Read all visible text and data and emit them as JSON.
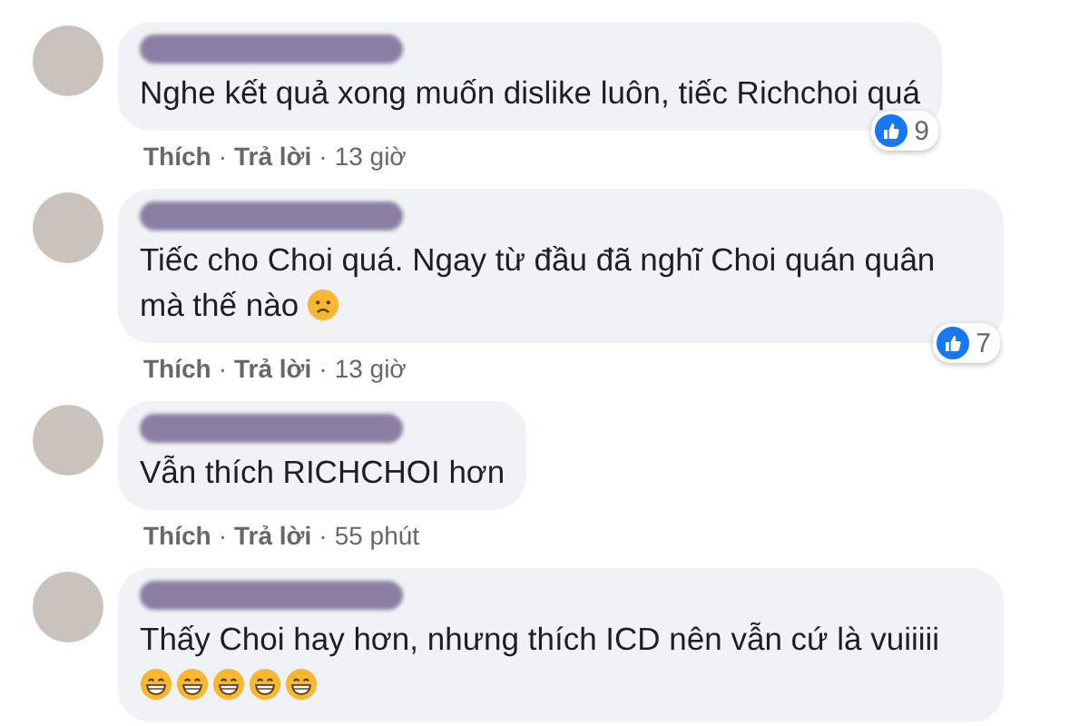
{
  "comments": [
    {
      "text": "Nghe kết quả xong muốn dislike luôn, tiếc Richchoi quá",
      "actions": [
        "Thích",
        "Trả lời"
      ],
      "separator": "·",
      "time": "13 giờ",
      "reaction_count": "9"
    },
    {
      "text": "Tiếc cho Choi quá. Ngay từ đầu đã nghĩ Choi quán quân mà thế nào",
      "emojis": [
        {
          "kind": "frown"
        }
      ],
      "actions": [
        "Thích",
        "Trả lời"
      ],
      "separator": "·",
      "time": "13 giờ",
      "reaction_count": "7"
    },
    {
      "text": "Vẫn thích RICHCHOI hơn",
      "actions": [
        "Thích",
        "Trả lời"
      ],
      "separator": "·",
      "time": "55 phút"
    },
    {
      "text": "Thấy Choi hay hơn, nhưng thích ICD nên vẫn cứ là vuiiiii",
      "emojis": [
        {
          "kind": "grin"
        },
        {
          "kind": "grin"
        },
        {
          "kind": "grin"
        },
        {
          "kind": "grin"
        },
        {
          "kind": "grin"
        }
      ]
    }
  ]
}
